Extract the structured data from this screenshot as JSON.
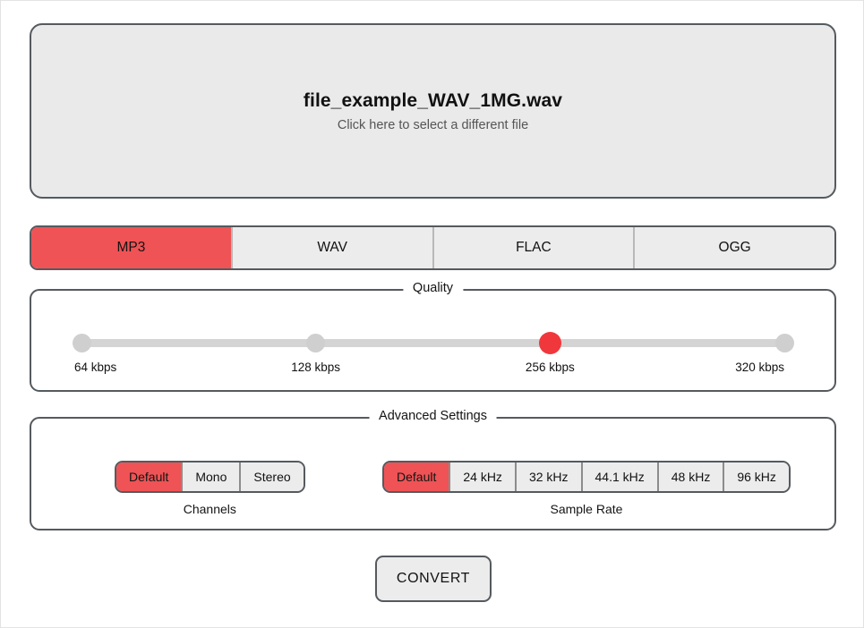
{
  "dropzone": {
    "filename": "file_example_WAV_1MG.wav",
    "hint": "Click here to select a different file"
  },
  "formats": {
    "selected": "MP3",
    "tabs": [
      {
        "label": "MP3"
      },
      {
        "label": "WAV"
      },
      {
        "label": "FLAC"
      },
      {
        "label": "OGG"
      }
    ]
  },
  "quality": {
    "legend": "Quality",
    "selected": "256 kbps",
    "stops": [
      {
        "label": "64 kbps"
      },
      {
        "label": "128 kbps"
      },
      {
        "label": "256 kbps"
      },
      {
        "label": "320 kbps"
      }
    ]
  },
  "advanced": {
    "legend": "Advanced Settings",
    "channels": {
      "caption": "Channels",
      "selected": "Default",
      "options": [
        {
          "label": "Default"
        },
        {
          "label": "Mono"
        },
        {
          "label": "Stereo"
        }
      ]
    },
    "sample_rate": {
      "caption": "Sample Rate",
      "selected": "Default",
      "options": [
        {
          "label": "Default"
        },
        {
          "label": "24 kHz"
        },
        {
          "label": "32 kHz"
        },
        {
          "label": "44.1 kHz"
        },
        {
          "label": "48 kHz"
        },
        {
          "label": "96 kHz"
        }
      ]
    }
  },
  "actions": {
    "convert_label": "CONVERT"
  },
  "colors": {
    "accent": "#ef5355",
    "slider_handle": "#f0383c",
    "panel_border": "#555a5e",
    "surface": "#ececec",
    "dropzone_bg": "#eaeaea"
  }
}
